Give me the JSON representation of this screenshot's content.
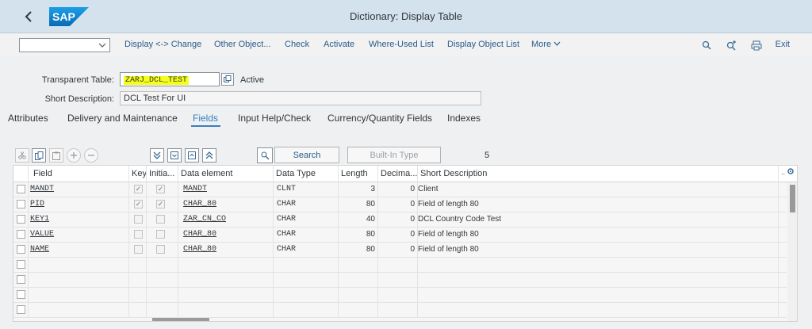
{
  "window": {
    "title": "Dictionary: Display Table",
    "logo": "SAP"
  },
  "toolbar": {
    "items": [
      "Display <-> Change",
      "Other Object...",
      "Check",
      "Activate",
      "Where-Used List",
      "Display Object List",
      "More"
    ],
    "more_chevron": "chevron-down-icon",
    "exit": "Exit"
  },
  "header": {
    "table_label": "Transparent Table:",
    "table_name": "ZARJ_DCL_TEST",
    "status": "Active",
    "desc_label": "Short Description:",
    "desc_value": "DCL Test For UI"
  },
  "tabs": [
    "Attributes",
    "Delivery and Maintenance",
    "Fields",
    "Input Help/Check",
    "Currency/Quantity Fields",
    "Indexes"
  ],
  "active_tab": "Fields",
  "table_toolbar": {
    "search_label": "Search",
    "builtin_label": "Built-In Type",
    "count": "5"
  },
  "grid": {
    "headers": [
      "Field",
      "Key",
      "Initia...",
      "Data element",
      "Data Type",
      "Length",
      "Decima...",
      "Short Description"
    ],
    "rows": [
      {
        "field": "MANDT",
        "key": true,
        "initial": true,
        "element": "MANDT",
        "type": "CLNT",
        "length": "3",
        "decimals": "0",
        "desc": "Client"
      },
      {
        "field": "PID",
        "key": true,
        "initial": true,
        "element": "CHAR_80",
        "type": "CHAR",
        "length": "80",
        "decimals": "0",
        "desc": "Field of  length 80"
      },
      {
        "field": "KEY1",
        "key": false,
        "initial": false,
        "element": "ZAR_CN_CO",
        "type": "CHAR",
        "length": "40",
        "decimals": "0",
        "desc": "DCL Country Code Test"
      },
      {
        "field": "VALUE",
        "key": false,
        "initial": false,
        "element": "CHAR_80",
        "type": "CHAR",
        "length": "80",
        "decimals": "0",
        "desc": "Field of  length 80"
      },
      {
        "field": "NAME",
        "key": false,
        "initial": false,
        "element": "CHAR_80",
        "type": "CHAR",
        "length": "80",
        "decimals": "0",
        "desc": "Field of  length 80"
      }
    ],
    "empty_rows": 4
  },
  "colors": {
    "accent": "#3a7fc1",
    "highlight": "#f5ff1a",
    "titlebar": "#d4e2ee"
  }
}
